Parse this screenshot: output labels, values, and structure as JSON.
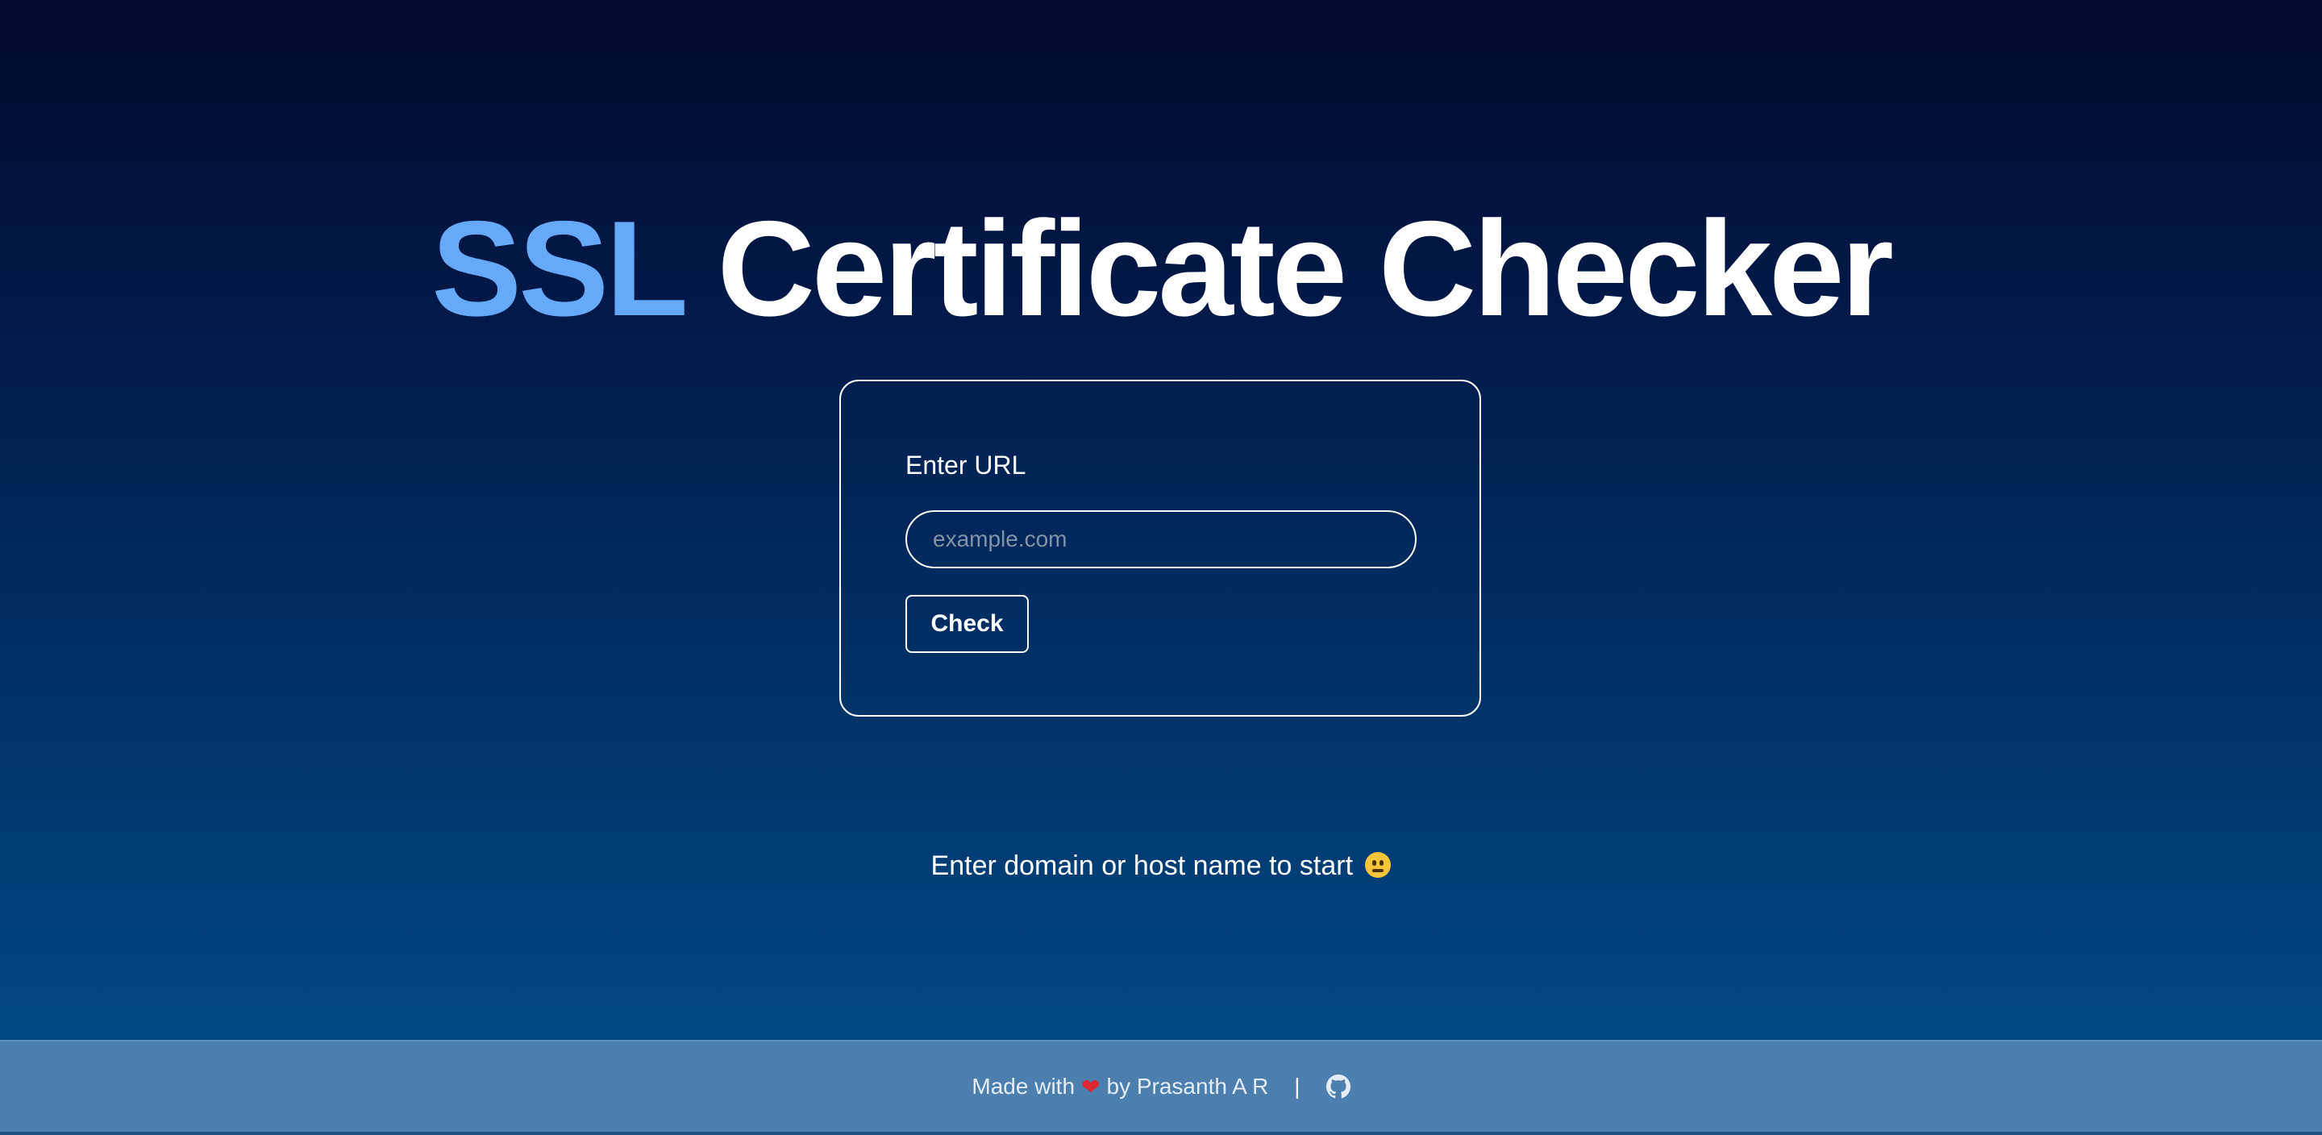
{
  "header": {
    "title_accent": "SSL",
    "title_rest": "Certificate Checker"
  },
  "form": {
    "label": "Enter URL",
    "input_placeholder": "example.com",
    "input_value": "",
    "check_button_label": "Check"
  },
  "hint": {
    "text": "Enter domain or host name to start",
    "emoji_icon": "neutral-face-emoji"
  },
  "footer": {
    "made_with": "Made with",
    "heart_icon": "❤",
    "by_text": "by Prasanth A R",
    "separator": "|",
    "github_icon": "github-icon"
  },
  "colors": {
    "accent": "#65a9f8",
    "footer_bg": "#4c7fae",
    "heart": "#e0262f"
  }
}
